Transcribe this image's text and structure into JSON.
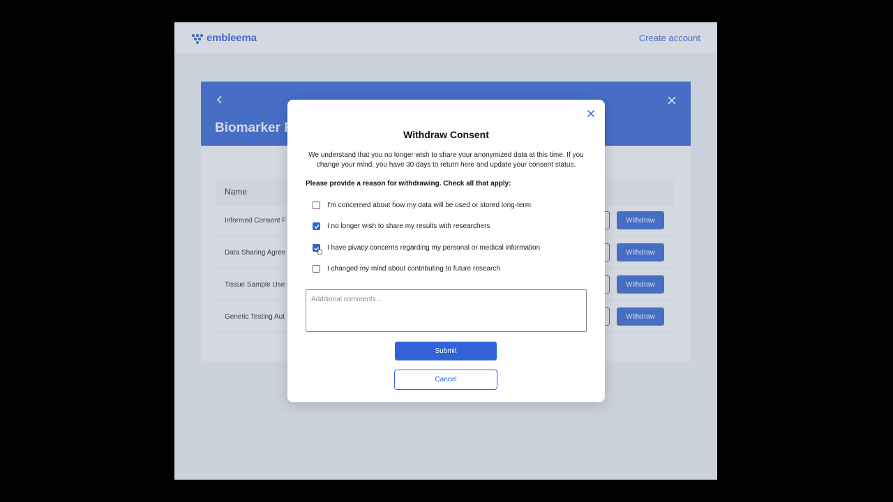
{
  "topbar": {
    "brand": "embleema",
    "create_account": "Create account"
  },
  "page": {
    "title": "Biomarker F",
    "table": {
      "header_name": "Name",
      "rows": [
        {
          "name": "Informed Consent F",
          "action": "Withdraw"
        },
        {
          "name": "Data Sharing Agree",
          "action": "Withdraw"
        },
        {
          "name": "Tissue Sample Use C",
          "action": "Withdraw"
        },
        {
          "name": "Genetic Testing Aut",
          "action": "Withdraw"
        }
      ]
    }
  },
  "modal": {
    "title": "Withdraw Consent",
    "description": "We understand that you no longer wish to share your anonymized data at this time. If you change your mind, you have 30 days to return here and update your consent status.",
    "prompt": "Please provide a reason for withdrawing. Check all that apply:",
    "options": [
      {
        "label": "I'm concerned about how my data will be used or stored long-term",
        "checked": false
      },
      {
        "label": "I no longer wish to share my results with researchers",
        "checked": true
      },
      {
        "label": "I have pivacy concerns regarding my personal or medical information",
        "checked": true
      },
      {
        "label": "I changed my mind about contributing to future research",
        "checked": false
      }
    ],
    "comments_placeholder": "Additional comments...",
    "submit_label": "Submit",
    "cancel_label": "Cancel"
  },
  "colors": {
    "brand": "#2f63d6"
  },
  "icons": {
    "logo": "embleema-logo-icon",
    "back": "chevron-left-icon",
    "close": "close-icon",
    "check": "checkmark-icon",
    "cursor": "pointer-cursor-icon"
  }
}
